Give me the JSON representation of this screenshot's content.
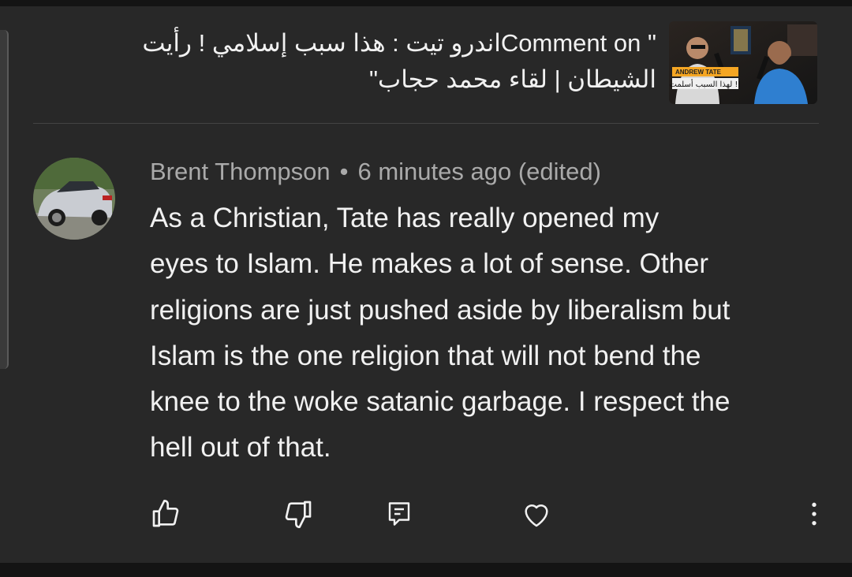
{
  "header": {
    "prefix": "Comment on \"",
    "video_title_line1": "اندرو تيت : هذا سبب إسلامي ! رأيت",
    "video_title_line2": "الشيطان | لقاء محمد حجاب",
    "suffix": "\"",
    "thumbnail_caption_top": "ANDREW TATE",
    "thumbnail_caption": "لهذا السبب أسلمت !!"
  },
  "comment": {
    "author": "Brent Thompson",
    "separator": "•",
    "time": "6 minutes ago (edited)",
    "text_lines": [
      "As a Christian, Tate has really opened my",
      "eyes to Islam. He makes a lot of sense. Other",
      "religions are just pushed aside by liberalism but",
      "Islam is the one religion that will not bend the",
      "knee to the woke satanic garbage. I respect the",
      "hell out of that."
    ]
  },
  "actions": [
    {
      "icon": "thumbs-up-icon"
    },
    {
      "icon": "thumbs-down-icon"
    },
    {
      "icon": "reply-icon"
    },
    {
      "icon": "heart-icon"
    },
    {
      "icon": "more-vertical-icon"
    }
  ],
  "colors": {
    "background": "#282828",
    "text": "#f1f1f1",
    "meta_text": "#aaaaaa"
  }
}
